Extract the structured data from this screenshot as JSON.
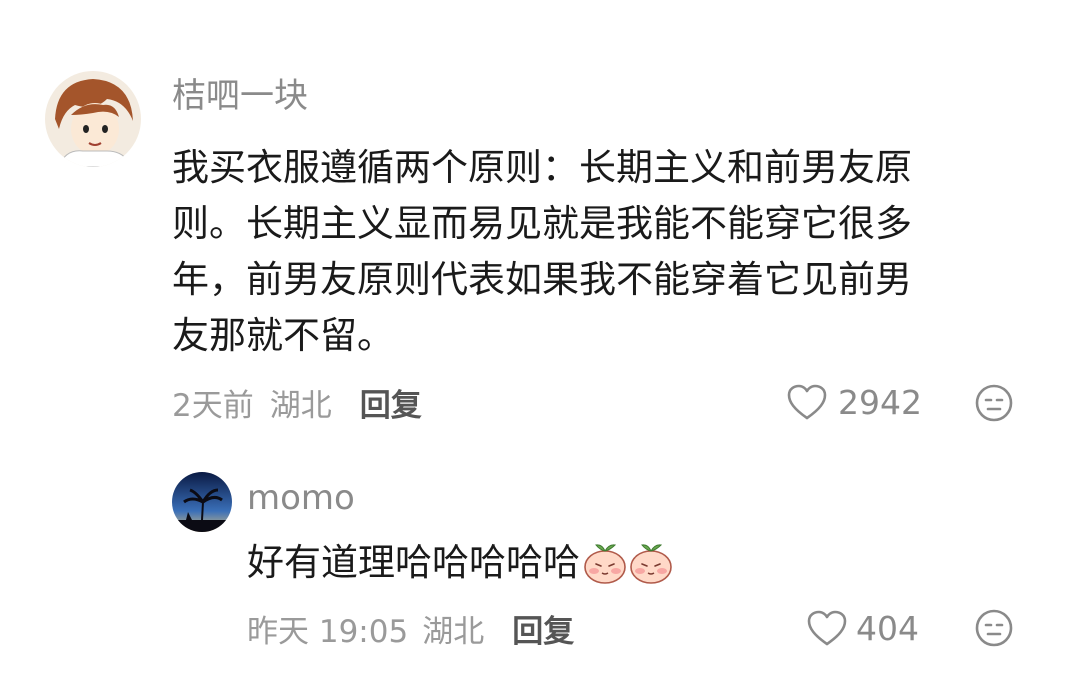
{
  "comments": [
    {
      "username": "桔呬一块",
      "lines": [
        "我买衣服遵循两个原则：长期主义和前男友原",
        "则。长期主义显而易见就是我能不能穿它很多",
        "年，前男友原则代表如果我不能穿着它见前男",
        "友那就不留。"
      ],
      "time": "2天前",
      "location": "湖北",
      "reply_label": "回复",
      "likes": "2942"
    },
    {
      "username": "momo",
      "text": "好有道理哈哈哈哈哈",
      "time": "昨天 19:05",
      "location": "湖北",
      "reply_label": "回复",
      "likes": "404"
    }
  ]
}
